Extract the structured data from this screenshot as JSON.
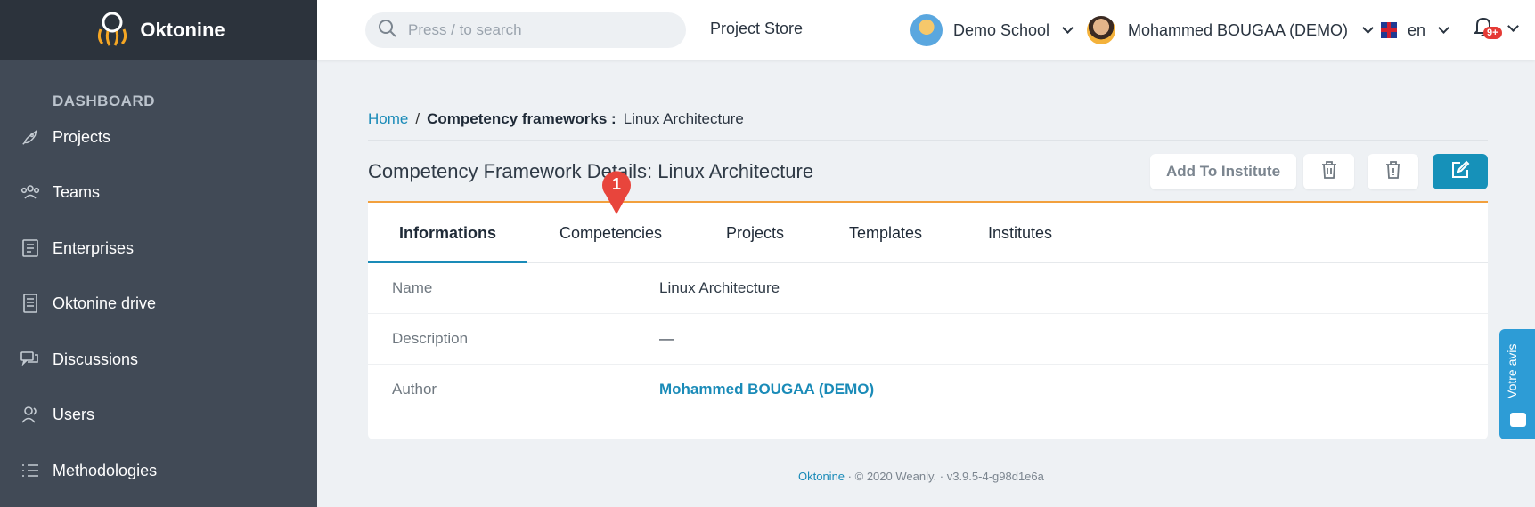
{
  "brand": {
    "name": "Oktonine"
  },
  "sidebar": {
    "section_title": "DASHBOARD",
    "items": [
      {
        "label": "Projects",
        "icon": "rocket-icon"
      },
      {
        "label": "Teams",
        "icon": "team-icon"
      },
      {
        "label": "Enterprises",
        "icon": "enterprise-icon"
      },
      {
        "label": "Oktonine drive",
        "icon": "drive-icon"
      },
      {
        "label": "Discussions",
        "icon": "discussions-icon"
      },
      {
        "label": "Users",
        "icon": "users-icon"
      },
      {
        "label": "Methodologies",
        "icon": "list-icon"
      }
    ]
  },
  "topbar": {
    "search_placeholder": "Press / to search",
    "project_store": "Project Store",
    "school": "Demo School",
    "user": "Mohammed BOUGAA (DEMO)",
    "language": "en",
    "notifications_badge": "9+"
  },
  "breadcrumb": {
    "home": "Home",
    "separator": "/",
    "section": "Competency frameworks :",
    "current": "Linux Architecture"
  },
  "page": {
    "title": "Competency Framework Details: Linux Architecture",
    "add_button": "Add To Institute"
  },
  "tabs": [
    "Informations",
    "Competencies",
    "Projects",
    "Templates",
    "Institutes"
  ],
  "details": [
    {
      "label": "Name",
      "value": "Linux Architecture"
    },
    {
      "label": "Description",
      "value": "—"
    },
    {
      "label": "Author",
      "value": "Mohammed BOUGAA (DEMO)"
    }
  ],
  "marker": {
    "number": "1"
  },
  "footer": {
    "link": "Oktonine",
    "sep": "·",
    "copyright": "© 2020 Weanly.",
    "version": "v3.9.5-4-g98d1e6a"
  },
  "feedback": {
    "label": "Votre avis"
  },
  "colors": {
    "accent": "#1a8bb8",
    "sidebar": "#414a56",
    "tab_border": "#f2a03d",
    "marker": "#e8453c"
  }
}
